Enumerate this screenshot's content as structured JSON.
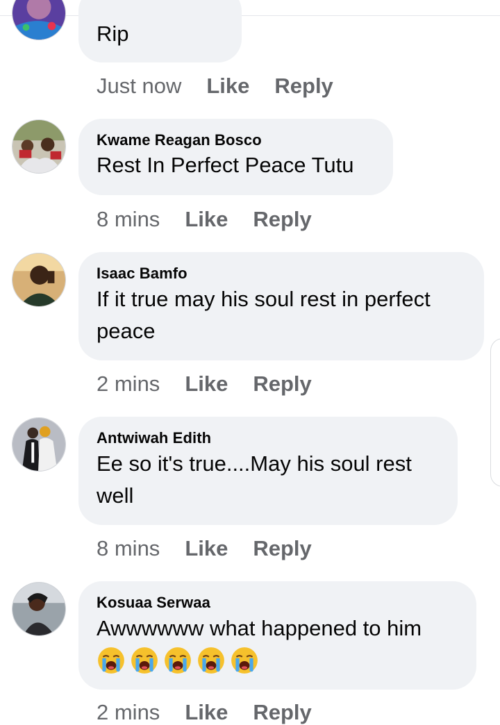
{
  "comments": [
    {
      "author": "",
      "text": "Rip",
      "time": "Just now",
      "like": "Like",
      "reply": "Reply"
    },
    {
      "author": "Kwame Reagan Bosco",
      "text": "Rest In Perfect Peace Tutu",
      "time": "8 mins",
      "like": "Like",
      "reply": "Reply"
    },
    {
      "author": "Isaac Bamfo",
      "text": "If it true may his soul rest in perfect peace",
      "time": "2 mins",
      "like": "Like",
      "reply": "Reply"
    },
    {
      "author": "Antwiwah Edith",
      "text": "Ee so it's true....May his soul rest well",
      "time": "8 mins",
      "like": "Like",
      "reply": "Reply"
    },
    {
      "author": "Kosuaa Serwaa",
      "text": "Awwwwww what happened to him",
      "emojis": [
        "loudly-crying-face-emoji",
        "loudly-crying-face-emoji",
        "loudly-crying-face-emoji",
        "loudly-crying-face-emoji",
        "loudly-crying-face-emoji"
      ],
      "time": "2 mins",
      "like": "Like",
      "reply": "Reply"
    }
  ]
}
